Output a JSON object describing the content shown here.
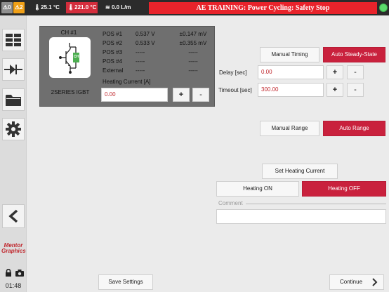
{
  "status_bar": {
    "alarm_grey_count": "0",
    "alarm_orange_count": "2",
    "temp1": "25.1 °C",
    "temp2": "221.0 °C",
    "flow": "0.0 L/m",
    "banner": "AE TRAINING: Power Cycling: Safety Stop",
    "status_color": "#5cdb6b",
    "banner_color": "#e8232b"
  },
  "sidebar": {
    "items": [
      {
        "name": "grid-view",
        "icon": "grid-icon"
      },
      {
        "name": "diode",
        "icon": "diode-icon"
      },
      {
        "name": "folder",
        "icon": "folder-icon"
      },
      {
        "name": "settings",
        "icon": "gear-icon"
      },
      {
        "name": "back",
        "icon": "chevron-left-icon"
      }
    ],
    "logo": "Mentor Graphics",
    "logo_line1": "Mentor",
    "logo_line2": "Graphics",
    "time": "01:48"
  },
  "channel": {
    "title": "CH #1",
    "icon_tag": "CH",
    "device": "2SERIES IGBT",
    "positions": [
      {
        "label": "POS #1",
        "v": "0.537 V",
        "mv": "±0.147 mV"
      },
      {
        "label": "POS #2",
        "v": "0.533 V",
        "mv": "±0.355 mV"
      },
      {
        "label": "POS #3",
        "v": "-----",
        "mv": "-----"
      },
      {
        "label": "POS #4",
        "v": "-----",
        "mv": "-----"
      },
      {
        "label": "External",
        "v": "-----",
        "mv": "-----"
      }
    ],
    "heating_current_label": "Heating Current [A]",
    "heating_current_value": "0.00",
    "plus": "+",
    "minus": "-"
  },
  "timing": {
    "manual_label": "Manual Timing",
    "auto_label": "Auto Steady-State",
    "delay_label": "Delay [sec]",
    "delay_value": "0.00",
    "timeout_label": "Timeout [sec]",
    "timeout_value": "300.00",
    "plus": "+",
    "minus": "-"
  },
  "range": {
    "manual_label": "Manual Range",
    "auto_label": "Auto Range"
  },
  "heating": {
    "set_current_label": "Set Heating Current",
    "on_label": "Heating ON",
    "off_label": "Heating OFF"
  },
  "comment": {
    "label": "Comment",
    "value": ""
  },
  "bottom": {
    "save_label": "Save Settings",
    "continue_label": "Continue"
  },
  "colors": {
    "accent_red": "#c9213d",
    "value_red": "#c0272d",
    "panel_grey": "#6f6f6f"
  }
}
